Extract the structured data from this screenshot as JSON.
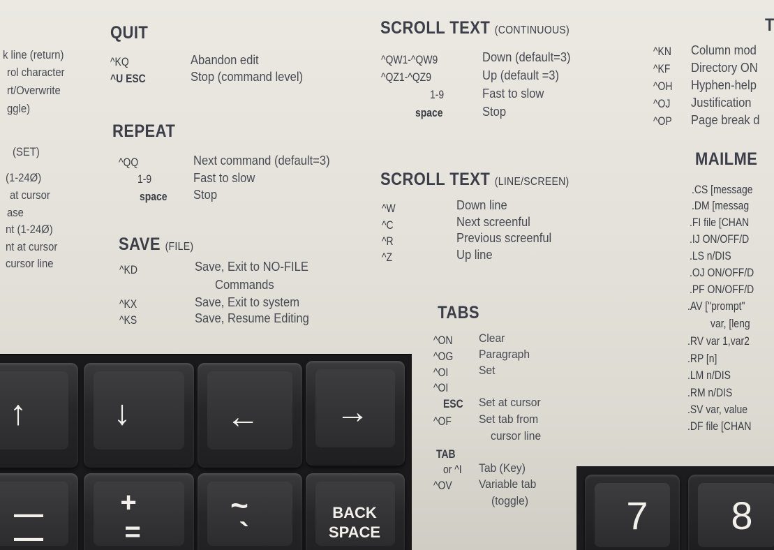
{
  "left_column": {
    "lines": [
      "k line (return)",
      "rol character",
      "rt/Overwrite",
      "ggle)",
      "(SET)",
      "(1-24Ø)",
      "at cursor",
      "ase",
      "nt (1-24Ø)",
      "nt at cursor",
      "cursor line"
    ]
  },
  "quit": {
    "title": "QUIT",
    "rows": [
      {
        "key": "^KQ",
        "desc": "Abandon edit"
      },
      {
        "key": "^U ESC",
        "desc": "Stop (command level)"
      }
    ]
  },
  "repeat": {
    "title": "REPEAT",
    "rows": [
      {
        "key": "^QQ",
        "desc": "Next command (default=3)"
      },
      {
        "key": "1-9",
        "desc": "Fast to slow"
      },
      {
        "key": "space",
        "desc": "Stop"
      }
    ]
  },
  "save": {
    "title": "SAVE",
    "subtitle": "(FILE)",
    "rows": [
      {
        "key": "^KD",
        "desc": "Save, Exit to NO-FILE"
      },
      {
        "key": "",
        "desc": "Commands"
      },
      {
        "key": "^KX",
        "desc": "Save, Exit to system"
      },
      {
        "key": "^KS",
        "desc": "Save, Resume Editing"
      }
    ]
  },
  "scroll_continuous": {
    "title": "SCROLL TEXT",
    "subtitle": "(CONTINUOUS)",
    "rows": [
      {
        "key": "^QW1-^QW9",
        "desc": "Down (default=3)"
      },
      {
        "key": "^QZ1-^QZ9",
        "desc": "Up (default =3)"
      },
      {
        "key": "1-9",
        "desc": "Fast to slow"
      },
      {
        "key": "space",
        "desc": "Stop"
      }
    ]
  },
  "scroll_line": {
    "title": "SCROLL TEXT",
    "subtitle": "(LINE/SCREEN)",
    "rows": [
      {
        "key": "^W",
        "desc": "Down line"
      },
      {
        "key": "^C",
        "desc": "Next screenful"
      },
      {
        "key": "^R",
        "desc": "Previous screenful"
      },
      {
        "key": "^Z",
        "desc": "Up line"
      }
    ]
  },
  "tabs": {
    "title": "TABS",
    "rows": [
      {
        "key": "^ON",
        "desc": "Clear"
      },
      {
        "key": "^OG",
        "desc": "Paragraph"
      },
      {
        "key": "^OI",
        "desc": "Set"
      },
      {
        "key": "^OI",
        "desc": ""
      },
      {
        "key": "ESC",
        "desc": "Set at cursor"
      },
      {
        "key": "^OF",
        "desc": "Set tab from"
      },
      {
        "key": "",
        "desc": "cursor line"
      },
      {
        "key": "TAB",
        "desc": ""
      },
      {
        "key": "or ^I",
        "desc": "Tab (Key)"
      },
      {
        "key": "^OV",
        "desc": "Variable tab"
      },
      {
        "key": "",
        "desc": "(toggle)"
      }
    ]
  },
  "onscreen": {
    "title_fragment": "T",
    "rows": [
      {
        "key": "^KN",
        "desc": "Column mod"
      },
      {
        "key": "^KF",
        "desc": "Directory ON"
      },
      {
        "key": "^OH",
        "desc": "Hyphen-help"
      },
      {
        "key": "^OJ",
        "desc": "Justification"
      },
      {
        "key": "^OP",
        "desc": "Page break d"
      }
    ]
  },
  "mailmerge": {
    "title": "MAILME",
    "lines": [
      ".CS [message",
      ".DM [messag",
      ".FI file [CHAN",
      ".IJ ON/OFF/D",
      ".LS n/DIS",
      ".OJ ON/OFF/D",
      ".PF ON/OFF/D",
      ".AV [\"prompt\"",
      "var, [leng",
      ".RV var 1,var2",
      ".RP [n]",
      ".LM n/DIS",
      ".RM n/DIS",
      ".SV var, value",
      ".DF file [CHAN"
    ]
  },
  "keyboard": {
    "up_arrow": "↑",
    "down_arrow": "↓",
    "left_arrow": "←",
    "right_arrow": "→",
    "minus_top": "—",
    "minus_bottom": "—",
    "plus_top": "+",
    "plus_bottom": "=",
    "tilde_top": "~",
    "tilde_bottom": "`",
    "backspace_line1": "BACK",
    "backspace_line2": "SPACE",
    "seven": "7",
    "eight": "8"
  }
}
